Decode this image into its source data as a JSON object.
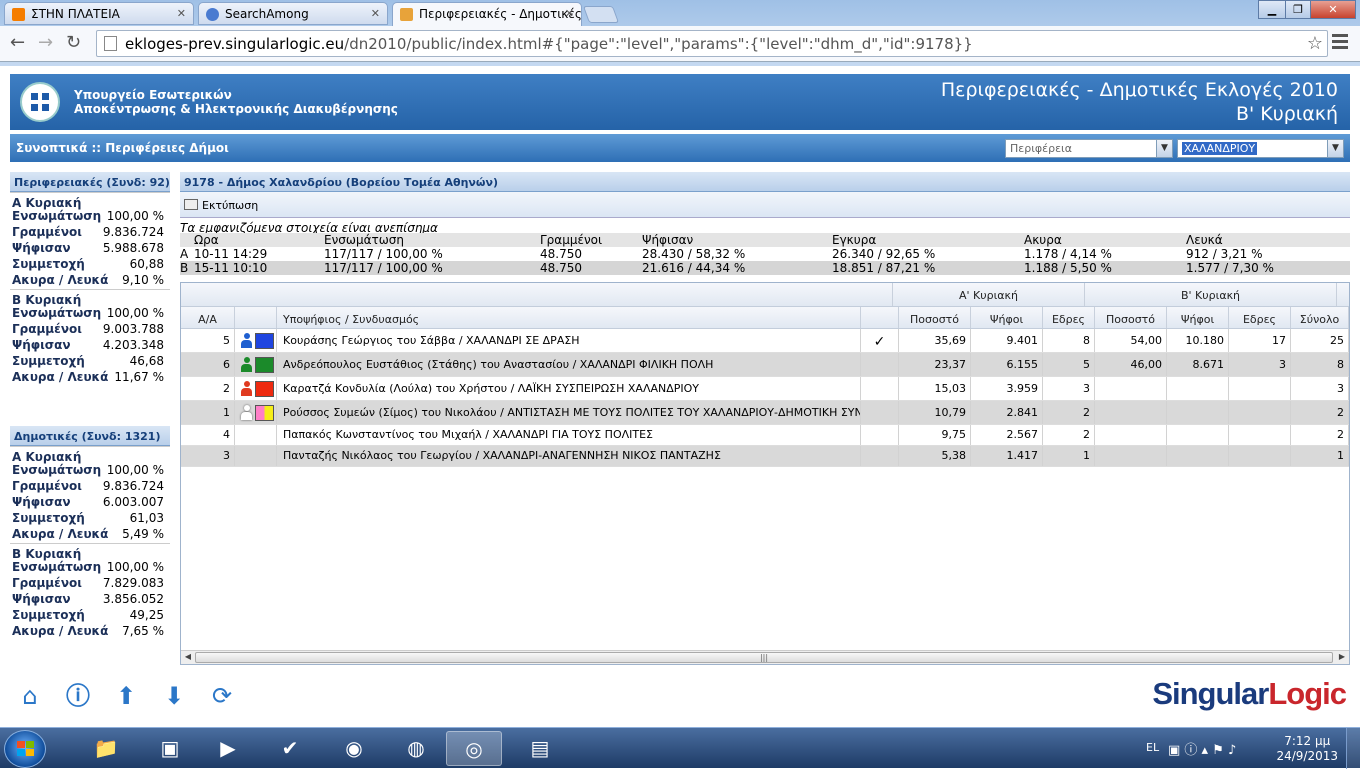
{
  "browser": {
    "tabs": [
      {
        "title": "ΣΤΗΝ ΠΛΑΤΕΙΑ",
        "favicon_color": "#f57d00"
      },
      {
        "title": "SearchAmong",
        "favicon_color": "#4a7bd0"
      },
      {
        "title": "Περιφερειακές - Δημοτικές",
        "favicon_color": "#e8a33a"
      }
    ],
    "url_host": "ekloges-prev.singularlogic.eu",
    "url_path": "/dn2010/public/index.html#{\"page\":\"level\",\"params\":{\"level\":\"dhm_d\",\"id\":9178}}"
  },
  "header": {
    "ministry_line1": "Υπουργείο Εσωτερικών",
    "ministry_line2": "Αποκέντρωσης & Ηλεκτρονικής Διακυβέρνησης",
    "title_line1": "Περιφερειακές - Δημοτικές Εκλογές 2010",
    "title_line2": "Β' Κυριακή"
  },
  "subbar": {
    "breadcrumb": "Συνοπτικά :: Περιφέρειες Δήμοι",
    "region_select": "Περιφέρεια",
    "municipality_select": "ΧΑΛΑΝΔΡΙΟΥ"
  },
  "left": {
    "regional": {
      "header": "Περιφερειακές (Συνδ: 92)",
      "rounds": [
        {
          "name": "Α Κυριακή",
          "rows": [
            {
              "k": "Ενσωμάτωση",
              "v": "100,00 %"
            },
            {
              "k": "Γραμμένοι",
              "v": "9.836.724"
            },
            {
              "k": "Ψήφισαν",
              "v": "5.988.678"
            },
            {
              "k": "Συμμετοχή",
              "v": "60,88"
            },
            {
              "k": "Ακυρα / Λευκά",
              "v": "9,10 %"
            }
          ]
        },
        {
          "name": "Β Κυριακή",
          "rows": [
            {
              "k": "Ενσωμάτωση",
              "v": "100,00 %"
            },
            {
              "k": "Γραμμένοι",
              "v": "9.003.788"
            },
            {
              "k": "Ψήφισαν",
              "v": "4.203.348"
            },
            {
              "k": "Συμμετοχή",
              "v": "46,68"
            },
            {
              "k": "Ακυρα / Λευκά",
              "v": "11,67 %"
            }
          ]
        }
      ]
    },
    "municipal": {
      "header": "Δημοτικές (Συνδ: 1321)",
      "rounds": [
        {
          "name": "Α Κυριακή",
          "rows": [
            {
              "k": "Ενσωμάτωση",
              "v": "100,00 %"
            },
            {
              "k": "Γραμμένοι",
              "v": "9.836.724"
            },
            {
              "k": "Ψήφισαν",
              "v": "6.003.007"
            },
            {
              "k": "Συμμετοχή",
              "v": "61,03"
            },
            {
              "k": "Ακυρα / Λευκά",
              "v": "5,49 %"
            }
          ]
        },
        {
          "name": "Β Κυριακή",
          "rows": [
            {
              "k": "Ενσωμάτωση",
              "v": "100,00 %"
            },
            {
              "k": "Γραμμένοι",
              "v": "7.829.083"
            },
            {
              "k": "Ψήφισαν",
              "v": "3.856.052"
            },
            {
              "k": "Συμμετοχή",
              "v": "49,25"
            },
            {
              "k": "Ακυρα / Λευκά",
              "v": "7,65 %"
            }
          ]
        }
      ]
    }
  },
  "main": {
    "title": "9178 - Δήμος Χαλανδρίου (Βορείου Τομέα Αθηνών)",
    "print_label": "Εκτύπωση",
    "note": "Τα εμφανιζόμενα στοιχεία είναι ανεπίσημα",
    "summary_headers": [
      "Ωρα",
      "Ενσωμάτωση",
      "Γραμμένοι",
      "Ψήφισαν",
      "Εγκυρα",
      "Ακυρα",
      "Λευκά"
    ],
    "summary_rows": [
      {
        "round": "Α",
        "time": "10-11 14:29",
        "ens": "117/117 / 100,00 %",
        "gram": "48.750",
        "psif": "28.430 / 58,32 %",
        "egk": "26.340 / 92,65 %",
        "akyra": "1.178 / 4,14 %",
        "lefka": "912 / 3,21 %"
      },
      {
        "round": "Β",
        "time": "15-11 10:10",
        "ens": "117/117 / 100,00 %",
        "gram": "48.750",
        "psif": "21.616 / 44,34 %",
        "egk": "18.851 / 87,21 %",
        "akyra": "1.188 / 5,50 %",
        "lefka": "1.577 / 7,30 %"
      }
    ],
    "grid_group_a": "Α' Κυριακή",
    "grid_group_b": "Β' Κυριακή",
    "grid_headers": [
      "Α/Α",
      "Υποψήφιος / Συνδυασμός",
      "Ποσοστό",
      "Ψήφοι",
      "Εδρες",
      "Ποσοστό",
      "Ψήφοι",
      "Εδρες",
      "Σύνολο"
    ],
    "rows": [
      {
        "aa": "5",
        "name": "Κουράσης Γεώργιος του Σάββα / ΧΑΛΑΝΔΡΙ ΣΕ ΔΡΑΣΗ",
        "check": "✓",
        "pa": "35,69",
        "va": "9.401",
        "sa": "8",
        "pb": "54,00",
        "vb": "10.180",
        "sb": "17",
        "tot": "25",
        "person": "#1f5fd0",
        "sw1": "#1f45e0",
        "sw2": "#1f45e0"
      },
      {
        "aa": "6",
        "name": "Ανδρεόπουλος Ευστάθιος (Στάθης) του Αναστασίου / ΧΑΛΑΝΔΡΙ ΦΙΛΙΚΗ ΠΟΛΗ",
        "check": "",
        "pa": "23,37",
        "va": "6.155",
        "sa": "5",
        "pb": "46,00",
        "vb": "8.671",
        "sb": "3",
        "tot": "8",
        "person": "#1b8a2a",
        "sw1": "#1b8a2a",
        "sw2": "#1b8a2a"
      },
      {
        "aa": "2",
        "name": "Καρατζά Κονδυλία (Λούλα) του Χρήστου / ΛΑΪΚΗ ΣΥΣΠΕΙΡΩΣΗ ΧΑΛΑΝΔΡΙΟΥ",
        "check": "",
        "pa": "15,03",
        "va": "3.959",
        "sa": "3",
        "pb": "",
        "vb": "",
        "sb": "",
        "tot": "3",
        "person": "#e03a1f",
        "sw1": "#ee2a10",
        "sw2": "#ee2a10"
      },
      {
        "aa": "1",
        "name": "Ρούσσος Συμεών (Σίμος) του Νικολάου / ΑΝΤΙΣΤΑΣΗ ΜΕ ΤΟΥΣ ΠΟΛΙΤΕΣ ΤΟΥ ΧΑΛΑΝΔΡΙΟΥ-ΔΗΜΟΤΙΚΗ ΣΥΝΕΡΓΑ...",
        "check": "",
        "pa": "10,79",
        "va": "2.841",
        "sa": "2",
        "pb": "",
        "vb": "",
        "sb": "",
        "tot": "2",
        "person": "#ffffff",
        "sw1": "#ff7fc8",
        "sw2": "#f6ee18"
      },
      {
        "aa": "4",
        "name": "Παπακός Κωνσταντίνος του Μιχαήλ / ΧΑΛΑΝΔΡΙ ΓΙΑ ΤΟΥΣ ΠΟΛΙΤΕΣ",
        "check": "",
        "pa": "9,75",
        "va": "2.567",
        "sa": "2",
        "pb": "",
        "vb": "",
        "sb": "",
        "tot": "2",
        "person": "",
        "sw1": "",
        "sw2": ""
      },
      {
        "aa": "3",
        "name": "Πανταζής Νικόλαος του Γεωργίου / ΧΑΛΑΝΔΡΙ-ΑΝΑΓΕΝΝΗΣΗ ΝΙΚΟΣ ΠΑΝΤΑΖΗΣ",
        "check": "",
        "pa": "5,38",
        "va": "1.417",
        "sa": "1",
        "pb": "",
        "vb": "",
        "sb": "",
        "tot": "1",
        "person": "",
        "sw1": "",
        "sw2": ""
      }
    ]
  },
  "brand": {
    "part1": "Singular",
    "part2": "Logic"
  },
  "taskbar": {
    "lang": "EL",
    "time": "7:12 μμ",
    "date": "24/9/2013"
  }
}
